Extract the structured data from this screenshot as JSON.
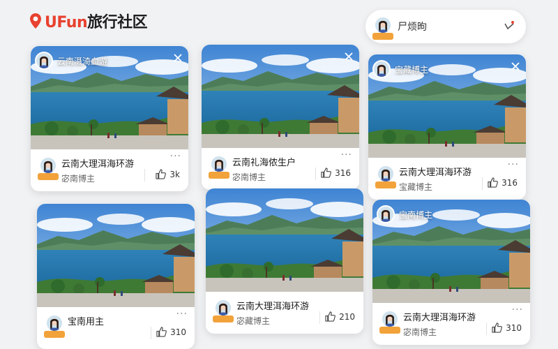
{
  "app": {
    "brand": "UFun",
    "title_rest": "旅行社区"
  },
  "profile": {
    "name": "尸烦昫"
  },
  "colors": {
    "accent": "#e8412f",
    "badge": "#f2a23a"
  },
  "icons": {
    "logo": "map-pin-icon",
    "notification": "bell-icon",
    "close": "close-icon",
    "more": "more-icon",
    "like": "thumbs-up-icon"
  },
  "cards": [
    {
      "overlay_label": "云南滠渏血游",
      "title": "云南大理洱海环游",
      "badge": "",
      "subtitle": "宓南博主",
      "more": "···",
      "likes": "3k"
    },
    {
      "overlay_label": "",
      "title": "云南礼海侬生户",
      "badge": "",
      "subtitle": "宓南博主",
      "more": "···",
      "likes": "316"
    },
    {
      "overlay_label": "宝藏博主",
      "title": "云南大理洱海环游",
      "badge": "",
      "subtitle": "宝藏博主",
      "more": "···",
      "likes": "316"
    },
    {
      "overlay_label": "",
      "title": "宝南用主",
      "badge": "",
      "subtitle": "",
      "more": "···",
      "likes": "310"
    },
    {
      "overlay_label": "",
      "title": "云南大理洱海环游",
      "badge": "",
      "subtitle": "宓藏博主",
      "more": "",
      "likes": "210"
    },
    {
      "overlay_label": "宝南博主",
      "title": "云南大理洱海环游",
      "badge": "",
      "subtitle": "宓南博主",
      "more": "···",
      "likes": "310"
    }
  ]
}
